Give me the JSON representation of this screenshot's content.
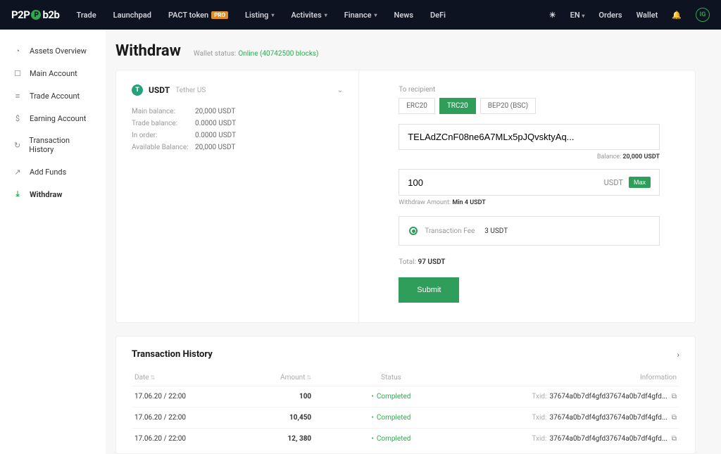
{
  "nav": {
    "logo_left": "P2P",
    "logo_right": "b2b",
    "items": [
      "Trade",
      "Launchpad",
      "PACT token",
      "Listing",
      "Activites",
      "Finance",
      "News",
      "DeFi"
    ],
    "pro_badge": "PRO",
    "lang": "EN",
    "orders": "Orders",
    "wallet": "Wallet",
    "avatar": "IG"
  },
  "sidebar": {
    "items": [
      {
        "label": "Assets Overview",
        "icon": "◔"
      },
      {
        "label": "Main Account",
        "icon": "☐"
      },
      {
        "label": "Trade Account",
        "icon": "≡"
      },
      {
        "label": "Earning Account",
        "icon": "$"
      },
      {
        "label": "Transaction History",
        "icon": "↻"
      },
      {
        "label": "Add Funds",
        "icon": "↗"
      },
      {
        "label": "Withdraw",
        "icon": "⤓",
        "active": true
      }
    ]
  },
  "page": {
    "title": "Withdraw",
    "wallet_status_label": "Wallet status:",
    "wallet_status_value": "Online (40742500 blocks)"
  },
  "coin": {
    "symbol": "USDT",
    "name": "Tether US",
    "balances": [
      {
        "label": "Main balance:",
        "value": "20,000 USDT"
      },
      {
        "label": "Trade balance:",
        "value": "0.0000 USDT"
      },
      {
        "label": "In order:",
        "value": "0.0000 USDT"
      },
      {
        "label": "Available Balance:",
        "value": "20,000 USDT"
      }
    ]
  },
  "withdraw": {
    "recipient_label": "To recipient",
    "networks": [
      "ERC20",
      "TRC20",
      "BEP20 (BSC)"
    ],
    "active_network": "TRC20",
    "address": "TELAdZCnF08ne6A7MLx5pJQvsktyAq...",
    "balance_label": "Balance:",
    "balance_value": "20,000 USDT",
    "amount": "100",
    "amount_unit": "USDT",
    "max_label": "Max",
    "min_label": "Withdraw Amount:",
    "min_value": "Min 4 USDT",
    "fee_label": "Transaction Fee",
    "fee_value": "3 USDT",
    "total_label": "Total:",
    "total_value": "97 USDT",
    "submit": "Submit"
  },
  "history": {
    "title": "Transaction History",
    "cols": {
      "date": "Date",
      "amount": "Amount",
      "status": "Status",
      "info": "Information"
    },
    "rows": [
      {
        "date": "17.06.20 / 22:00",
        "amount": "100",
        "status": "Completed",
        "txid": "37674a0b7df4gfd37674a0b7df4gfd..."
      },
      {
        "date": "17.06.20 / 22:00",
        "amount": "10,450",
        "status": "Completed",
        "txid": "37674a0b7df4gfd37674a0b7df4gfd..."
      },
      {
        "date": "17.06.20 / 22:00",
        "amount": "12, 380",
        "status": "Completed",
        "txid": "37674a0b7df4gfd37674a0b7df4gfd..."
      }
    ],
    "txid_label": "Txid:"
  }
}
